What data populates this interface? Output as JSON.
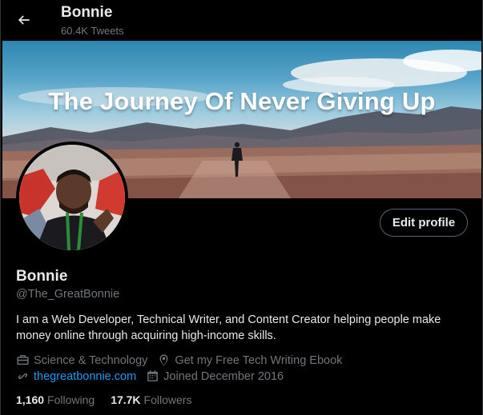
{
  "header": {
    "name": "Bonnie",
    "tweet_count": "60.4K Tweets"
  },
  "banner": {
    "title": "The Journey Of Never Giving Up"
  },
  "profile": {
    "display_name": "Bonnie",
    "handle": "@The_GreatBonnie",
    "bio": "I am a Web Developer, Technical Writer, and Content Creator helping people make money online through acquiring high-income skills.",
    "edit_label": "Edit profile",
    "category": "Science & Technology",
    "location": "Get my Free Tech Writing Ebook",
    "website": "thegreatbonnie.com",
    "joined": "Joined December 2016",
    "following_count": "1,160",
    "following_label": "Following",
    "followers_count": "17.7K",
    "followers_label": "Followers"
  },
  "icons": {
    "back": "arrow-left-icon",
    "category": "briefcase-icon",
    "location": "location-pin-icon",
    "website": "link-icon",
    "joined": "calendar-icon"
  },
  "colors": {
    "background": "#000000",
    "primary_text": "#e7e9ea",
    "secondary_text": "#71767b",
    "link": "#1d9bf0",
    "border": "#536471"
  }
}
